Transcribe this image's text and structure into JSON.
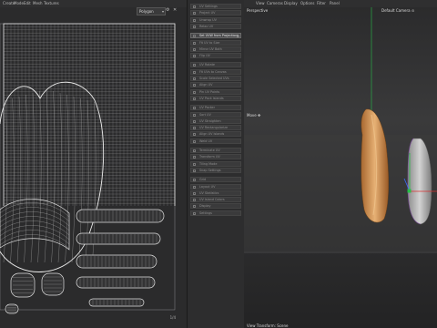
{
  "left_menu": [
    "Create",
    "Mode",
    "Edit",
    "Mesh",
    "Textures"
  ],
  "uv_editor": {
    "dropdown": "Polygon",
    "dropdown_arrow": "▾",
    "settings_glyph": "⚙",
    "close_glyph": "✕",
    "page": "1/4"
  },
  "commands": [
    {
      "label": "UV Settings",
      "highlight": false
    },
    {
      "label": "Project UV",
      "highlight": false
    },
    {
      "label": "Unwrap UV",
      "highlight": false
    },
    {
      "label": "Relax UV",
      "highlight": false
    },
    {
      "label": "Set UVW from Projection",
      "highlight": true
    },
    {
      "label": "Fit UV to Size",
      "highlight": false
    },
    {
      "label": "Mirror UV Both",
      "highlight": false
    },
    {
      "label": "Flip UV",
      "highlight": false
    },
    {
      "label": "UV Rotate",
      "highlight": false
    },
    {
      "label": "Fit UVs to Canvas",
      "highlight": false
    },
    {
      "label": "Scale Selected UVs",
      "highlight": false
    },
    {
      "label": "Align UV",
      "highlight": false
    },
    {
      "label": "Pin UV Points",
      "highlight": false
    },
    {
      "label": "UV Pack Islands",
      "highlight": false
    },
    {
      "label": "UV Packer",
      "highlight": false
    },
    {
      "label": "Sort UV",
      "highlight": false
    },
    {
      "label": "UV Straighten",
      "highlight": false
    },
    {
      "label": "UV Rectangularize",
      "highlight": false
    },
    {
      "label": "Align UV Islands",
      "highlight": false
    },
    {
      "label": "Weld UV",
      "highlight": false
    },
    {
      "label": "Terminate UV",
      "highlight": false
    },
    {
      "label": "Transform UV",
      "highlight": false
    },
    {
      "label": "Tiling Mode",
      "highlight": false
    },
    {
      "label": "Snap Settings",
      "highlight": false
    },
    {
      "label": "Grid",
      "highlight": false
    },
    {
      "label": "Layout UV",
      "highlight": false
    },
    {
      "label": "UV Statistics",
      "highlight": false
    },
    {
      "label": "UV Island Colors",
      "highlight": false
    },
    {
      "label": "Display",
      "highlight": false
    },
    {
      "label": "Settings",
      "highlight": false
    }
  ],
  "viewport": {
    "menu": [
      "View",
      "Cameras",
      "Display",
      "Options",
      "Filter",
      "Panel"
    ],
    "title": "Perspective",
    "camera": "Default Camera ⊙",
    "tool": "Move ✥",
    "status": "View Transform: Scene"
  },
  "colors": {
    "uv_line": "#d9d9d9",
    "uv_border": "#aaaaaa",
    "y_axis": "#27c04a",
    "x_axis": "#d83030",
    "z_axis": "#3a6bff",
    "bread_light": "#e6b074",
    "bread_dark": "#a86830"
  }
}
